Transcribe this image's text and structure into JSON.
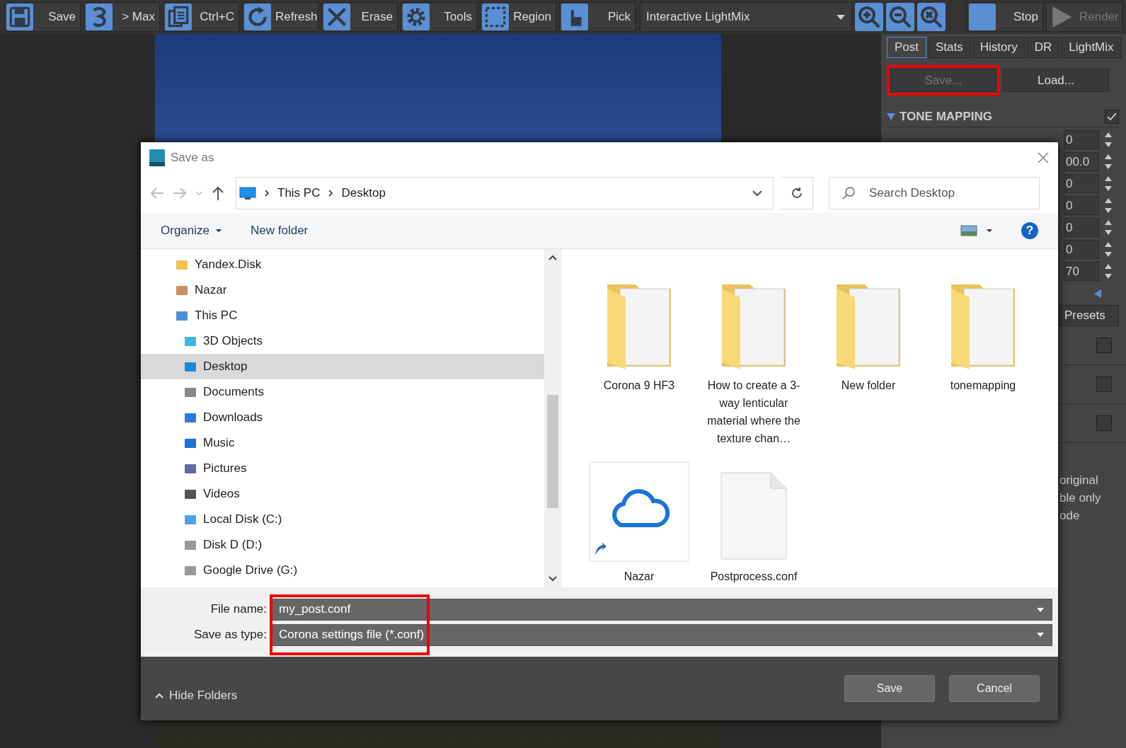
{
  "toolbar": {
    "buttons": [
      {
        "label": "Save"
      },
      {
        "label": "> Max"
      },
      {
        "label": "Ctrl+C"
      },
      {
        "label": "Refresh"
      },
      {
        "label": "Erase"
      },
      {
        "label": "Tools"
      },
      {
        "label": "Region"
      },
      {
        "label": "Pick"
      }
    ],
    "render_mode": {
      "value": "Interactive LightMix"
    },
    "stop_button": {
      "label": "Stop"
    },
    "render_button": {
      "label": "Render",
      "disabled": true
    }
  },
  "side_panel": {
    "tabs": [
      {
        "label": "Post",
        "selected": true
      },
      {
        "label": "Stats",
        "selected": false
      },
      {
        "label": "History",
        "selected": false
      },
      {
        "label": "DR",
        "selected": false
      },
      {
        "label": "LightMix",
        "selected": false
      }
    ],
    "save_button": {
      "label": "Save...",
      "disabled": true
    },
    "load_button": {
      "label": "Load...",
      "disabled": false
    },
    "section": {
      "title": "TONE MAPPING",
      "expanded": true,
      "checked": true
    },
    "spinner_values": [
      "0",
      "00.0",
      "0",
      "0",
      "0",
      "0",
      "70"
    ],
    "presets_button": "Presets",
    "options": [
      {
        "checked": false
      },
      {
        "checked": false
      },
      {
        "checked": false
      }
    ],
    "note_lines": [
      "original",
      "ble only",
      "ode"
    ]
  },
  "dialog": {
    "title": "Save as",
    "breadcrumb": [
      "This PC",
      "Desktop"
    ],
    "search": {
      "placeholder": "Search Desktop"
    },
    "commands": [
      "Organize",
      "New folder"
    ],
    "help_button": "?",
    "tree": [
      {
        "label": "Yandex.Disk",
        "selected": false
      },
      {
        "label": "Nazar",
        "selected": false
      },
      {
        "label": "This PC",
        "selected": false,
        "children": [
          {
            "label": "3D Objects",
            "selected": false
          },
          {
            "label": "Desktop",
            "selected": true
          },
          {
            "label": "Documents",
            "selected": false
          },
          {
            "label": "Downloads",
            "selected": false
          },
          {
            "label": "Music",
            "selected": false
          },
          {
            "label": "Pictures",
            "selected": false
          },
          {
            "label": "Videos",
            "selected": false
          },
          {
            "label": "Local Disk (C:)",
            "selected": false
          },
          {
            "label": "Disk D (D:)",
            "selected": false
          },
          {
            "label": "Google Drive (G:)",
            "selected": false
          }
        ]
      }
    ],
    "files": [
      {
        "name": "Corona 9 HF3",
        "kind": "folder"
      },
      {
        "name": "How to create a 3-way lenticular material where the texture chan…",
        "kind": "folder"
      },
      {
        "name": "New folder",
        "kind": "folder"
      },
      {
        "name": "tonemapping",
        "kind": "folder"
      },
      {
        "name": "Nazar",
        "kind": "shortcut"
      },
      {
        "name": "Postprocess.conf",
        "kind": "file"
      }
    ],
    "file_name": {
      "label": "File name:",
      "value": "my_post.conf"
    },
    "save_as_type": {
      "label": "Save as type:",
      "value": "Corona settings file (*.conf)"
    },
    "hide_folders": "Hide Folders",
    "buttons": [
      {
        "label": "Save"
      },
      {
        "label": "Cancel"
      }
    ]
  }
}
